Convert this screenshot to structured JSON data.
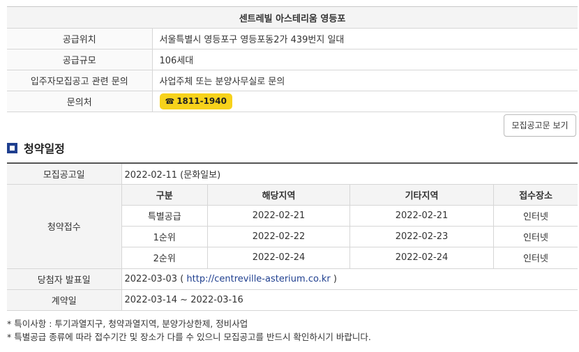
{
  "info": {
    "title": "센트레빌 아스테리움 영등포",
    "rows": [
      {
        "label": "공급위치",
        "value": "서울특별시 영등포구 영등포동2가 439번지 일대"
      },
      {
        "label": "공급규모",
        "value": "106세대"
      },
      {
        "label": "입주자모집공고 관련 문의",
        "value": "사업주체 또는 분양사무실로 문의"
      }
    ],
    "contact_label": "문의처",
    "phone_icon": "telephone-icon",
    "phone": "1811-1940",
    "badge_color": "#f7d21b"
  },
  "notice_button": "모집공고문 보기",
  "schedule": {
    "title": "청약일정",
    "announce_label": "모집공고일",
    "announce_value": "2022-02-11 (문화일보)",
    "apply_label": "청약접수",
    "apply_headers": [
      "구분",
      "해당지역",
      "기타지역",
      "접수장소"
    ],
    "apply_rows": [
      [
        "특별공급",
        "2022-02-21",
        "2022-02-21",
        "인터넷"
      ],
      [
        "1순위",
        "2022-02-22",
        "2022-02-23",
        "인터넷"
      ],
      [
        "2순위",
        "2022-02-24",
        "2022-02-24",
        "인터넷"
      ]
    ],
    "winner_label": "당첨자 발표일",
    "winner_date": "2022-03-03",
    "winner_paren_open": " ( ",
    "winner_url": "http://centreville-asterium.co.kr",
    "winner_paren_close": " )",
    "contract_label": "계약일",
    "contract_value": "2022-03-14 ~ 2022-03-16"
  },
  "notes": [
    "* 특이사항 : 투기과열지구, 청약과열지역, 분양가상한제, 정비사업",
    "* 특별공급 종류에 따라 접수기간 및 장소가 다를 수 있으니 모집공고를 반드시 확인하시기 바랍니다."
  ],
  "colors": {
    "accent": "#1f3f8f",
    "header_bg": "#f4f4f4"
  }
}
